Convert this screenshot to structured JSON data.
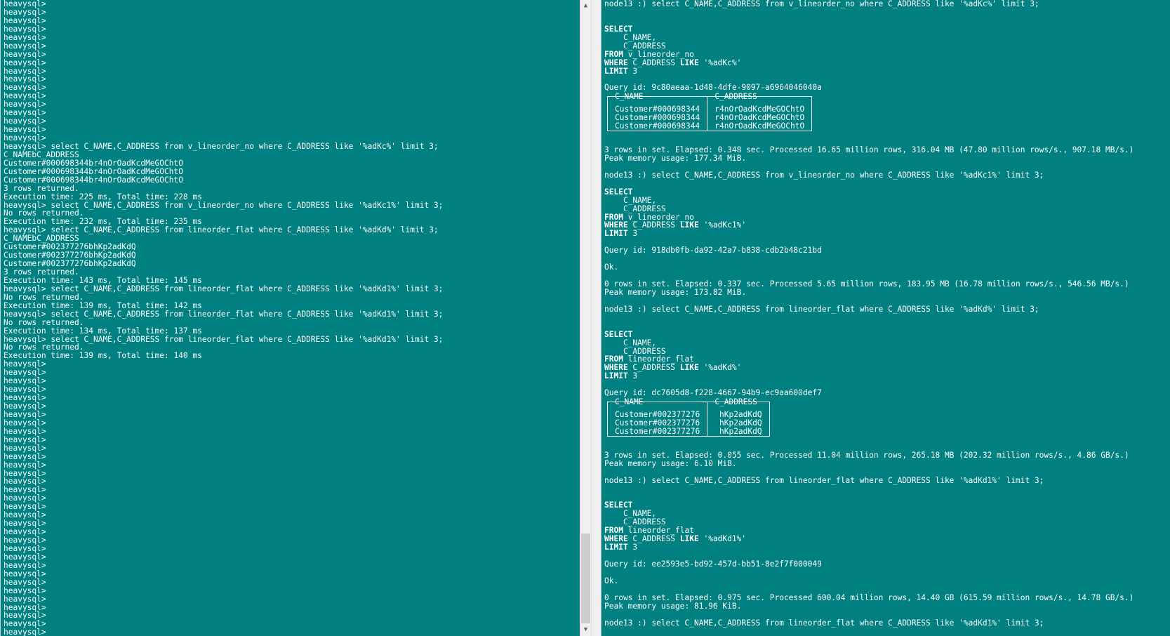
{
  "left_terminal": {
    "lines": [
      "heavysql>",
      "heavysql>",
      "heavysql>",
      "heavysql>",
      "heavysql>",
      "heavysql>",
      "heavysql>",
      "heavysql>",
      "heavysql>",
      "heavysql>",
      "heavysql>",
      "heavysql>",
      "heavysql>",
      "heavysql>",
      "heavysql>",
      "heavysql>",
      "heavysql>",
      "heavysql> select C_NAME,C_ADDRESS from v_lineorder_no where C_ADDRESS like '%adKc%' limit 3;",
      "C_NAMEbC_ADDRESS",
      "Customer#000698344br4nOrOadKcdMeGOChtO",
      "Customer#000698344br4nOrOadKcdMeGOChtO",
      "Customer#000698344br4nOrOadKcdMeGOChtO",
      "3 rows returned.",
      "Execution time: 225 ms, Total time: 228 ms",
      "heavysql> select C_NAME,C_ADDRESS from v_lineorder_no where C_ADDRESS like '%adKc1%' limit 3;",
      "No rows returned.",
      "Execution time: 232 ms, Total time: 235 ms",
      "heavysql> select C_NAME,C_ADDRESS from lineorder_flat where C_ADDRESS like '%adKd%' limit 3;",
      "C_NAMEbC_ADDRESS",
      "Customer#002377276bhKp2adKdQ",
      "Customer#002377276bhKp2adKdQ",
      "Customer#002377276bhKp2adKdQ",
      "3 rows returned.",
      "Execution time: 143 ms, Total time: 145 ms",
      "heavysql> select C_NAME,C_ADDRESS from lineorder_flat where C_ADDRESS like '%adKd1%' limit 3;",
      "No rows returned.",
      "Execution time: 139 ms, Total time: 142 ms",
      "heavysql> select C_NAME,C_ADDRESS from lineorder_flat where C_ADDRESS like '%adKd1%' limit 3;",
      "No rows returned.",
      "Execution time: 134 ms, Total time: 137 ms",
      "heavysql> select C_NAME,C_ADDRESS from lineorder_flat where C_ADDRESS like '%adKd1%' limit 3;",
      "No rows returned.",
      "Execution time: 139 ms, Total time: 140 ms",
      "heavysql>",
      "heavysql>",
      "heavysql>",
      "heavysql>",
      "heavysql>",
      "heavysql>",
      "heavysql>",
      "heavysql>",
      "heavysql>",
      "heavysql>",
      "heavysql>",
      "heavysql>",
      "heavysql>",
      "heavysql>",
      "heavysql>",
      "heavysql>",
      "heavysql>",
      "heavysql>",
      "heavysql>",
      "heavysql>",
      "heavysql>",
      "heavysql>",
      "heavysql>",
      "heavysql>",
      "heavysql>",
      "heavysql>",
      "heavysql>",
      "heavysql>",
      "heavysql>",
      "heavysql>",
      "heavysql>",
      "heavysql>",
      "heavysql>"
    ]
  },
  "right_terminal": {
    "blocks": [
      {
        "prompt": "node13 :) select C_NAME,C_ADDRESS from v_lineorder_no where C_ADDRESS like '%adKc%' limit 3;",
        "sql": [
          "SELECT",
          "    C_NAME,",
          "    C_ADDRESS",
          "FROM v_lineorder_no",
          "WHERE C_ADDRESS LIKE '%adKc%'",
          "LIMIT 3"
        ],
        "query_id": "Query id: 9c80aeaa-1d48-4dfe-9097-a6964046040a",
        "columns": [
          "C_NAME",
          "C_ADDRESS"
        ],
        "rows": [
          [
            "Customer#000698344",
            "r4nOrOadKcdMeGOChtO"
          ],
          [
            "Customer#000698344",
            "r4nOrOadKcdMeGOChtO"
          ],
          [
            "Customer#000698344",
            "r4nOrOadKcdMeGOChtO"
          ]
        ],
        "status": "",
        "summary": "3 rows in set. Elapsed: 0.348 sec. Processed 16.65 million rows, 316.04 MB (47.80 million rows/s., 907.18 MB/s.)",
        "memory": "Peak memory usage: 177.34 MiB."
      },
      {
        "prompt": "node13 :) select C_NAME,C_ADDRESS from v_lineorder_no where C_ADDRESS like '%adKc1%' limit 3;",
        "sql": [
          "SELECT",
          "    C_NAME,",
          "    C_ADDRESS",
          "FROM v_lineorder_no",
          "WHERE C_ADDRESS LIKE '%adKc1%'",
          "LIMIT 3"
        ],
        "query_id": "Query id: 918db0fb-da92-42a7-b838-cdb2b48c21bd",
        "columns": [],
        "rows": [],
        "status": "Ok.",
        "summary": "0 rows in set. Elapsed: 0.337 sec. Processed 5.65 million rows, 183.95 MB (16.78 million rows/s., 546.56 MB/s.)",
        "memory": "Peak memory usage: 173.82 MiB."
      },
      {
        "prompt": "node13 :) select C_NAME,C_ADDRESS from lineorder_flat where C_ADDRESS like '%adKd%' limit 3;",
        "sql": [
          "SELECT",
          "    C_NAME,",
          "    C_ADDRESS",
          "FROM lineorder_flat",
          "WHERE C_ADDRESS LIKE '%adKd%'",
          "LIMIT 3"
        ],
        "query_id": "Query id: dc7605d8-f228-4667-94b9-ec9aa600def7",
        "columns": [
          "C_NAME",
          "C_ADDRESS"
        ],
        "rows": [
          [
            "Customer#002377276",
            " hKp2adKdQ"
          ],
          [
            "Customer#002377276",
            " hKp2adKdQ"
          ],
          [
            "Customer#002377276",
            " hKp2adKdQ"
          ]
        ],
        "status": "",
        "summary": "3 rows in set. Elapsed: 0.055 sec. Processed 11.04 million rows, 265.18 MB (202.32 million rows/s., 4.86 GB/s.)",
        "memory": "Peak memory usage: 6.10 MiB."
      },
      {
        "prompt": "node13 :) select C_NAME,C_ADDRESS from lineorder_flat where C_ADDRESS like '%adKd1%' limit 3;",
        "sql": [
          "SELECT",
          "    C_NAME,",
          "    C_ADDRESS",
          "FROM lineorder_flat",
          "WHERE C_ADDRESS LIKE '%adKd1%'",
          "LIMIT 3"
        ],
        "query_id": "Query id: ee2593e5-bd92-457d-bb51-8e2f7f000049",
        "columns": [],
        "rows": [],
        "status": "Ok.",
        "summary": "0 rows in set. Elapsed: 0.975 sec. Processed 600.04 million rows, 14.40 GB (615.59 million rows/s., 14.78 GB/s.)",
        "memory": "Peak memory usage: 81.96 KiB."
      }
    ],
    "final_prompt": "node13 :) select C_NAME,C_ADDRESS from lineorder_flat where C_ADDRESS like '%adKd1%' limit 3;"
  },
  "scrollbar": {
    "up_icon": "▲",
    "down_icon": "▼"
  },
  "colors": {
    "terminal_bg": "#008080",
    "text": "#ffffff",
    "scrollbar_bg": "#f0f0f0"
  }
}
